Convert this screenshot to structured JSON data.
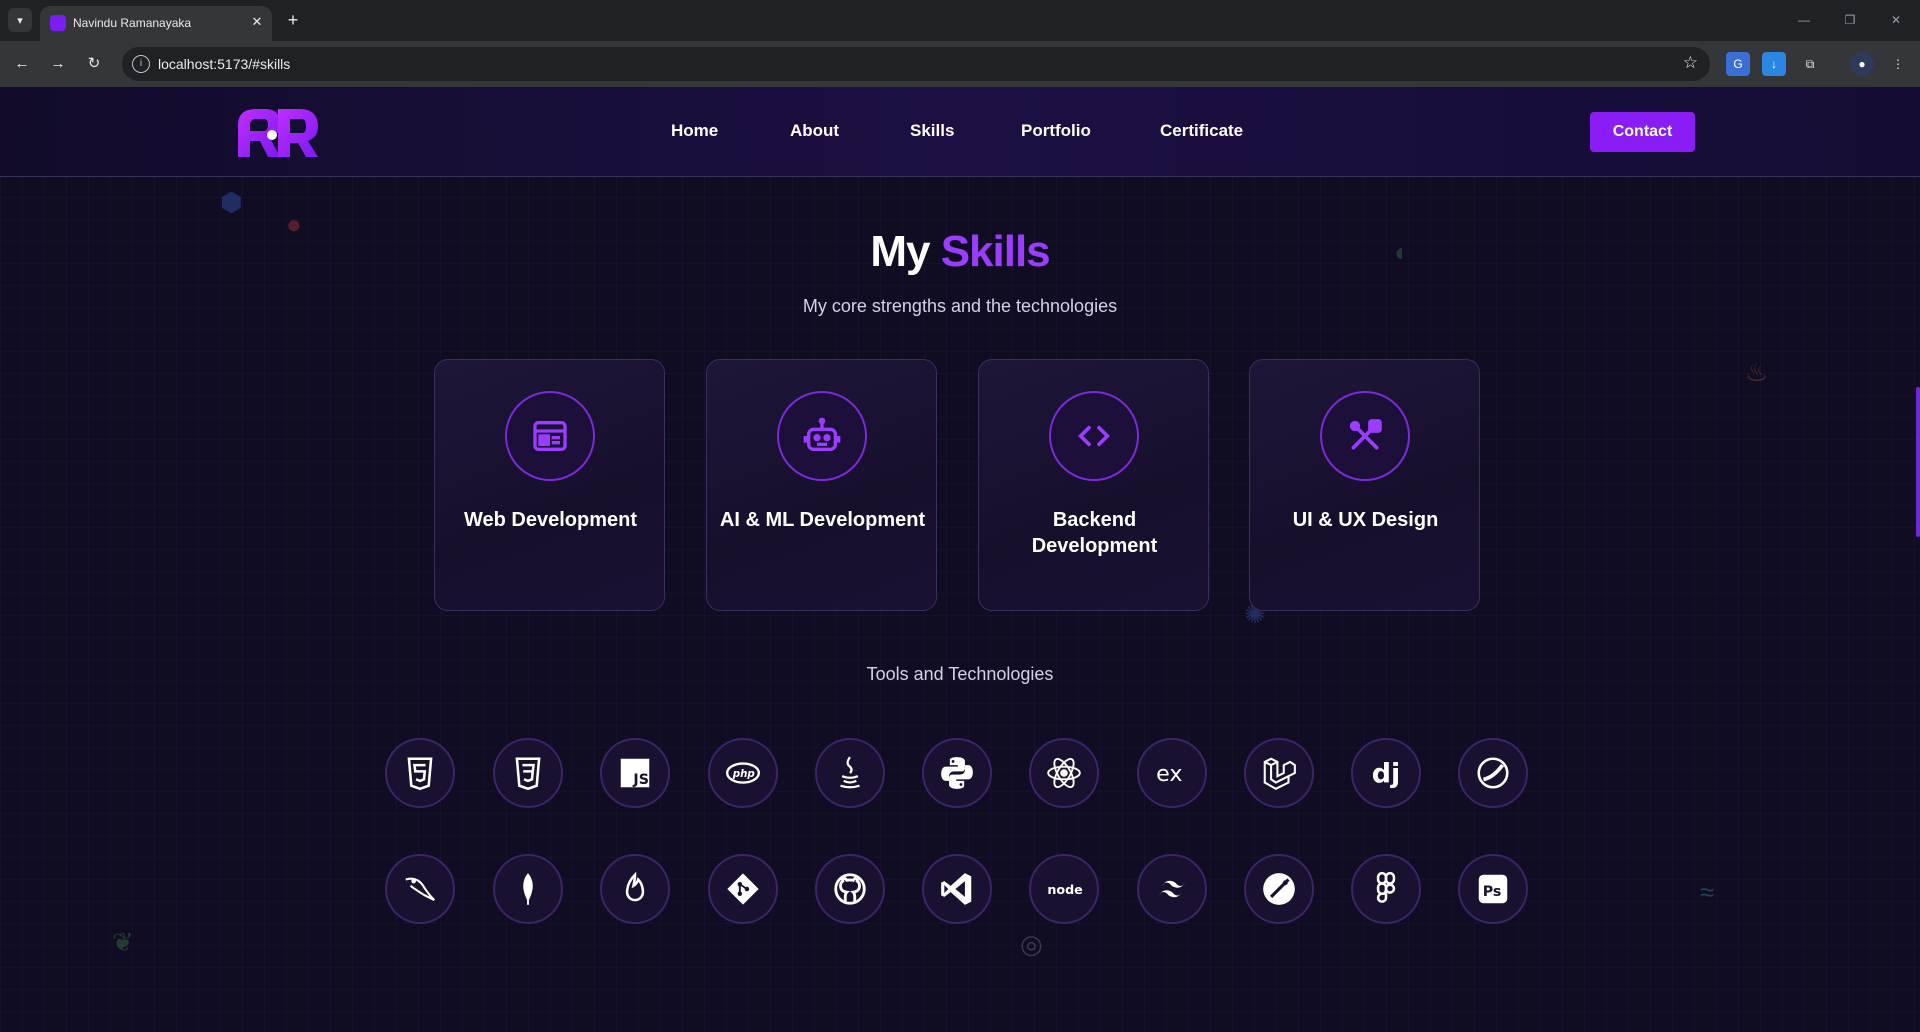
{
  "browser": {
    "tab_title": "Navindu Ramanayaka",
    "tab_close": "✕",
    "new_tab": "+",
    "url": "localhost:5173/#skills"
  },
  "nav": {
    "links": [
      "Home",
      "About",
      "Skills",
      "Portfolio",
      "Certificate"
    ],
    "contact": "Contact"
  },
  "section": {
    "title_plain": "My",
    "title_accent": "Skills",
    "subtitle": "My core strengths and the technologies"
  },
  "cards": [
    {
      "label": "Web Development",
      "icon": "web-window-icon"
    },
    {
      "label": "AI & ML Development",
      "icon": "robot-icon"
    },
    {
      "label": "Backend Development",
      "icon": "code-brackets-icon"
    },
    {
      "label": "UI & UX Design",
      "icon": "design-tools-icon"
    }
  ],
  "tools_title": "Tools and Technologies",
  "tools_row1": [
    "html5-icon",
    "css3-icon",
    "javascript-icon",
    "php-icon",
    "java-icon",
    "python-icon",
    "react-icon",
    "express-icon",
    "laravel-icon",
    "django-icon",
    "spring-icon"
  ],
  "tools_row2": [
    "mysql-icon",
    "mongodb-icon",
    "firebase-icon",
    "git-icon",
    "github-icon",
    "vscode-icon",
    "nodejs-icon",
    "tailwind-icon",
    "postman-icon",
    "figma-icon",
    "photoshop-icon"
  ],
  "colors": {
    "accent": "#9b3cff",
    "button": "#8a1cf5",
    "background": "#100c22",
    "card_border": "#3b2f5c",
    "icon_ring": "#7a2bd8"
  }
}
